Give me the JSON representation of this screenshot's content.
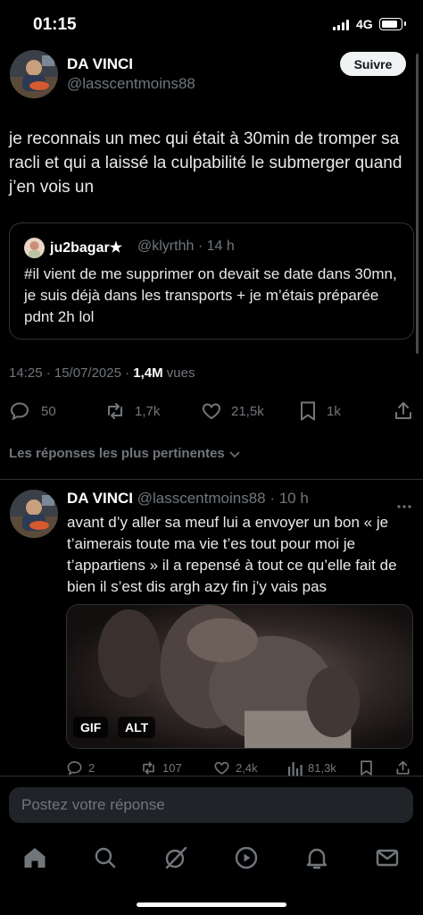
{
  "status_bar": {
    "time": "01:15",
    "network": "4G"
  },
  "tweet": {
    "author_name": "DA VINCI",
    "author_handle": "@lasscentmoins88",
    "follow_label": "Suivre",
    "text": "je reconnais un mec qui était à 30min de tromper sa racli et qui a laissé la culpabilité le submerger quand j’en vois un",
    "quote": {
      "name": "ju2bagar★",
      "handle": "@klyrthh · 14 h",
      "text": "#il vient de me supprimer on devait se date dans 30mn, je suis déjà dans les transports + je m’étais préparée pdnt 2h lol"
    },
    "timestamp": "14:25 · 15/07/2025 · ",
    "views_count": "1,4M",
    "views_label": " vues",
    "actions": {
      "replies": "50",
      "reposts": "1,7k",
      "likes": "21,5k",
      "bookmarks": "1k"
    }
  },
  "replies_section": {
    "label": "Les réponses les plus pertinentes"
  },
  "reply": {
    "name": "DA VINCI",
    "handle": "@lasscentmoins88 · 10 h",
    "text": "avant d’y aller sa meuf lui a envoyer un bon « je t’aimerais toute ma vie t’es tout pour moi je t’appartiens » il a repensé à tout ce qu’elle fait de bien il s’est dis argh azy fin j’y vais pas",
    "media_badges": {
      "gif": "GIF",
      "alt": "ALT"
    },
    "actions": {
      "replies": "2",
      "reposts": "107",
      "likes": "2,4k",
      "views": "81,3k"
    }
  },
  "composer": {
    "placeholder": "Postez votre réponse"
  },
  "nav": [
    "home-icon",
    "search-icon",
    "grok-icon",
    "video-icon",
    "notifications-icon",
    "messages-icon"
  ],
  "colors": {
    "background": "#000000",
    "text": "#e7e9ea",
    "muted": "#71767b",
    "border": "#2f3336"
  }
}
